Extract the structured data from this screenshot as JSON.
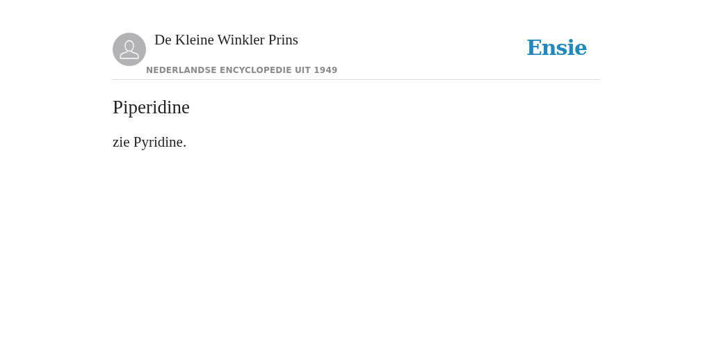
{
  "header": {
    "author": "De Kleine Winkler Prins",
    "subtitle": "NEDERLANDSE ENCYCLOPEDIE UIT 1949",
    "logo": "Ensie"
  },
  "article": {
    "title": "Piperidine",
    "body": "zie Pyridine."
  }
}
